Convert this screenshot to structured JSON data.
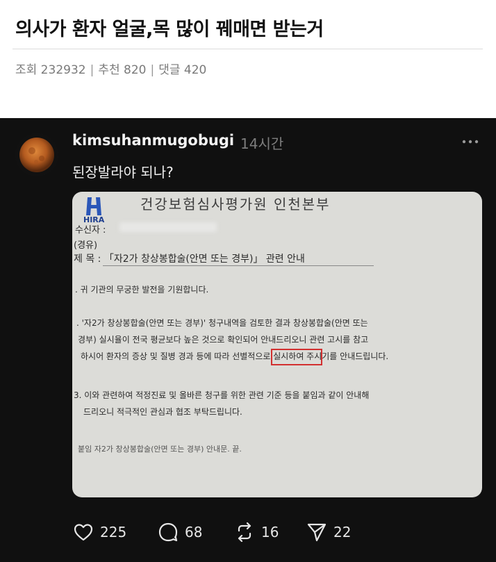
{
  "post": {
    "title": "의사가 환자 얼굴,목 많이 꿰매면 받는거",
    "meta": {
      "views": "조회 232932",
      "recommend": "추천 820",
      "comments": "댓글 420",
      "separator": "|"
    }
  },
  "thread": {
    "username": "kimsuhanmugobugi",
    "time": "14시간",
    "text": "된장발라야 되나?",
    "more_icon": "more-dots-icon",
    "actions": [
      {
        "icon": "heart-icon",
        "count": "225"
      },
      {
        "icon": "comment-icon",
        "count": "68"
      },
      {
        "icon": "repost-icon",
        "count": "16"
      },
      {
        "icon": "share-icon",
        "count": "22"
      }
    ]
  },
  "document": {
    "header": "건강보험심사평가원 인천본부",
    "logo": "HIRA",
    "recipient": "수신자 :",
    "via": "(경유)",
    "subject": "제  목 : 「자2가 창상봉합술(안면 또는 경부)」 관련 안내",
    "p1": ". 귀 기관의 무궁한 발전을 기원합니다.",
    "p2a": ". '자2가 창상봉합술(안면 또는 경부)' 청구내역을 검토한 결과 창상봉합술(안면 또는",
    "p2b": "경부) 실시율이 전국 평균보다 높은 것으로 확인되어 안내드리오니 관련 고시를 참고",
    "p2c": "하시어 환자의 증상 및 질병 경과 등에 따라 선별적으로 실시하여 주시기를 안내드립니다.",
    "p3a": "3. 이와 관련하여 적정진료 및 올바른 청구를 위한 관련 기준 등을 붙임과 같이 안내해",
    "p3b": "드리오니 적극적인 관심과 협조 부탁드립니다.",
    "attach": "붙임  자2가 창상봉합술(안면 또는 경부) 안내문.  끝."
  },
  "colors": {
    "background_dark": "#101010",
    "highlight_box": "#d23030",
    "meta_gray": "#7a7a7a"
  }
}
